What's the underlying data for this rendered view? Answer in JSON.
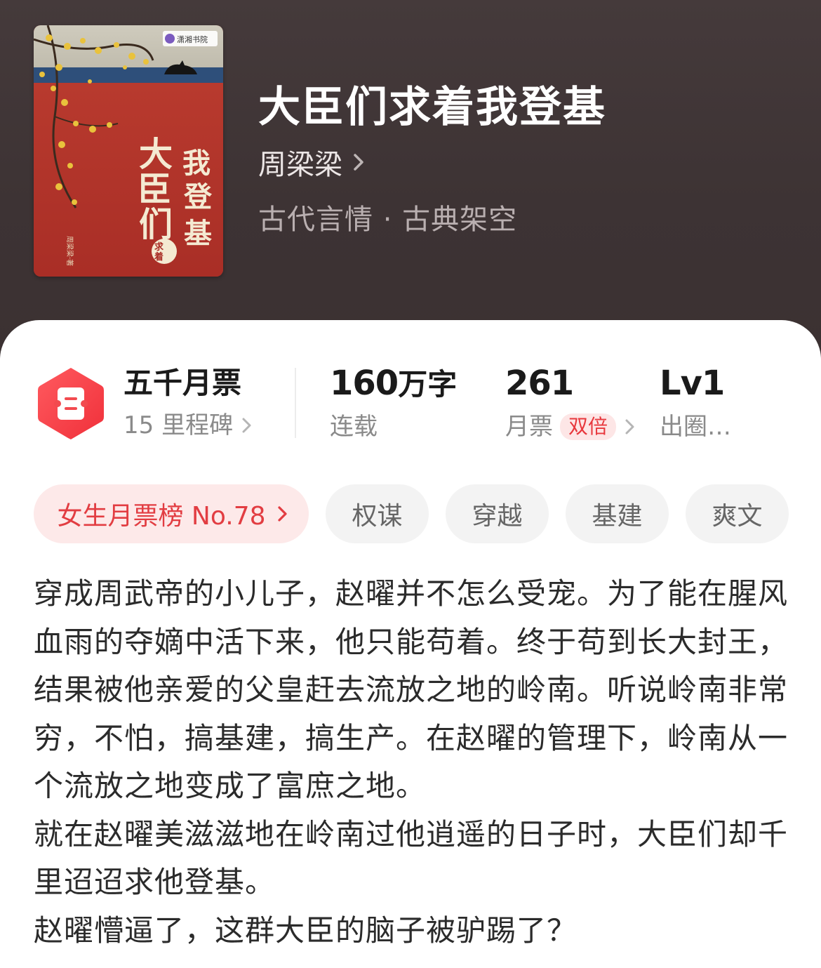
{
  "book": {
    "cover_publisher": "潇湘书院",
    "cover_title": "大臣们求着我登基",
    "cover_author": "周梁梁·著",
    "title": "大臣们求着我登基",
    "author": "周梁梁",
    "genre": "古代言情 · 古典架空"
  },
  "stats": {
    "tickets_main": "五千月票",
    "tickets_sub": "15 里程碑",
    "words_num": "160",
    "words_unit": "万字",
    "words_sub": "连载",
    "monthly_votes": "261",
    "monthly_sub": "月票",
    "double_badge": "双倍",
    "level": "Lv1",
    "level_sub": "出圈…"
  },
  "tags": {
    "rank": "女生月票榜 No.78",
    "items": [
      "权谋",
      "穿越",
      "基建",
      "爽文"
    ]
  },
  "synopsis": [
    "穿成周武帝的小儿子，赵曜并不怎么受宠。为了能在腥风血雨的夺嫡中活下来，他只能苟着。终于苟到长大封王，结果被他亲爱的父皇赶去流放之地的岭南。听说岭南非常穷，不怕，搞基建，搞生产。在赵曜的管理下，岭南从一个流放之地变成了富庶之地。",
    "就在赵曜美滋滋地在岭南过他逍遥的日子时，大臣们却千里迢迢求他登基。",
    "赵曜懵逼了，这群大臣的脑子被驴踢了？"
  ],
  "colors": {
    "header_bg": "#3d3334",
    "accent_red": "#e8383d",
    "rank_tag_bg": "#fde9e9",
    "tag_bg": "#f3f3f3"
  },
  "icons": {
    "ticket": "ticket-icon",
    "chevron": "chevron-right-icon"
  }
}
